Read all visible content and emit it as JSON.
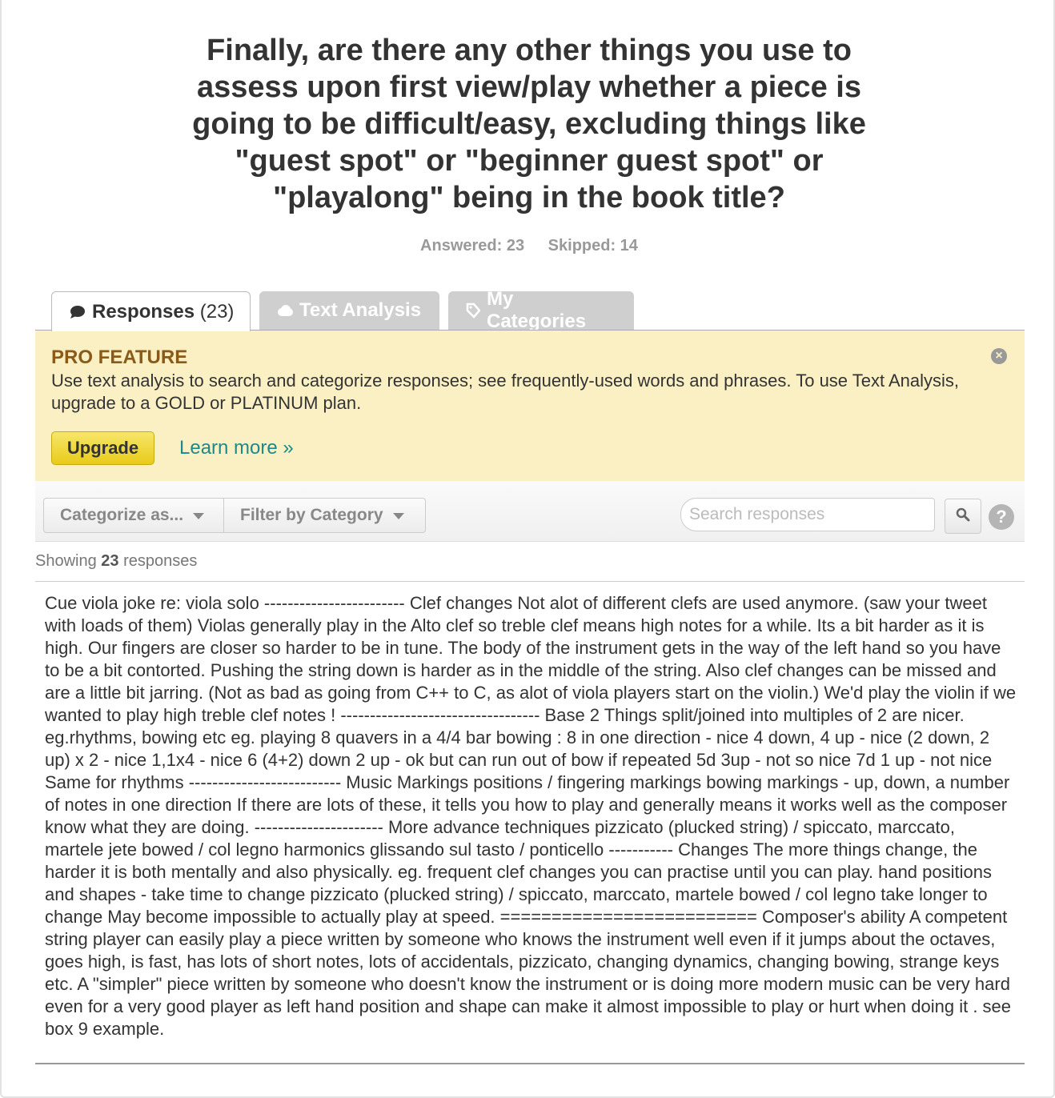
{
  "question": {
    "title": "Finally, are there any other things you use to assess upon first view/play whether a piece is going to be difficult/easy, excluding things like \"guest spot\" or \"beginner guest spot\" or \"playalong\" being in the book title?",
    "answered_label": "Answered: 23",
    "skipped_label": "Skipped: 14"
  },
  "tabs": [
    {
      "label": "Responses",
      "count": "(23)",
      "icon": "speech-bubble-icon"
    },
    {
      "label": "Text Analysis",
      "icon": "cloud-icon"
    },
    {
      "label": "My Categories",
      "icon": "tag-icon"
    }
  ],
  "pro_feature": {
    "title": "PRO FEATURE",
    "text": "Use text analysis to search and categorize responses; see frequently-used words and phrases. To use Text Analysis, upgrade to a GOLD or PLATINUM plan.",
    "upgrade_label": "Upgrade",
    "learn_more_label": "Learn more »",
    "close_icon": "close-circle-icon"
  },
  "toolbar": {
    "categorize_label": "Categorize as...",
    "filter_label": "Filter by Category",
    "search_placeholder": "Search responses",
    "search_icon": "magnifier-icon",
    "help_label": "?"
  },
  "showing": {
    "prefix": "Showing",
    "count": "23",
    "suffix": "responses"
  },
  "response": {
    "text": "Cue viola joke re: viola solo ------------------------ Clef changes Not alot of different clefs are used anymore. (saw your tweet with loads of them) Violas generally play in the Alto clef so treble clef means high notes for a while. Its a bit harder as it is high. Our fingers are closer so harder to be in tune. The body of the instrument gets in the way of the left hand so you have to be a bit contorted. Pushing the string down is harder as in the middle of the string. Also clef changes can be missed and are a little bit jarring. (Not as bad as going from C++ to C, as alot of viola players start on the violin.) We'd play the violin if we wanted to play high treble clef notes ! ---------------------------------- Base 2 Things split/joined into multiples of 2 are nicer. eg.rhythms, bowing etc eg. playing 8 quavers in a 4/4 bar bowing : 8 in one direction - nice 4 down, 4 up - nice (2 down, 2 up) x 2 - nice 1,1x4 - nice 6 (4+2) down 2 up - ok but can run out of bow if repeated 5d 3up - not so nice 7d 1 up - not nice Same for rhythms -------------------------- Music Markings positions / fingering markings bowing markings - up, down, a number of notes in one direction If there are lots of these, it tells you how to play and generally means it works well as the composer know what they are doing. ---------------------- More advance techniques pizzicato (plucked string) / spiccato, marccato, martele jete bowed / col legno harmonics glissando sul tasto / ponticello ----------- Changes The more things change, the harder it is both mentally and also physically. eg. frequent clef changes you can practise until you can play. hand positions and shapes - take time to change pizzicato (plucked string) / spiccato, marccato, martele bowed / col legno take longer to change May become impossible to actually play at speed. ========================= Composer's ability A competent string player can easily play a piece written by someone who knows the instrument well even if it jumps about the octaves, goes high, is fast, has lots of short notes, lots of accidentals, pizzicato, changing dynamics, changing bowing, strange keys etc. A \"simpler\" piece written by someone who doesn't know the instrument or is doing more modern music can be very hard even for a very good player as left hand position and shape can make it almost impossible to play or hurt when doing it . see box 9 example."
  },
  "colors": {
    "pro_bg": "#fbf0c4",
    "pro_title": "#8a5a19",
    "link": "#1a8a8a",
    "upgrade_btn": "#e8cb1a"
  }
}
